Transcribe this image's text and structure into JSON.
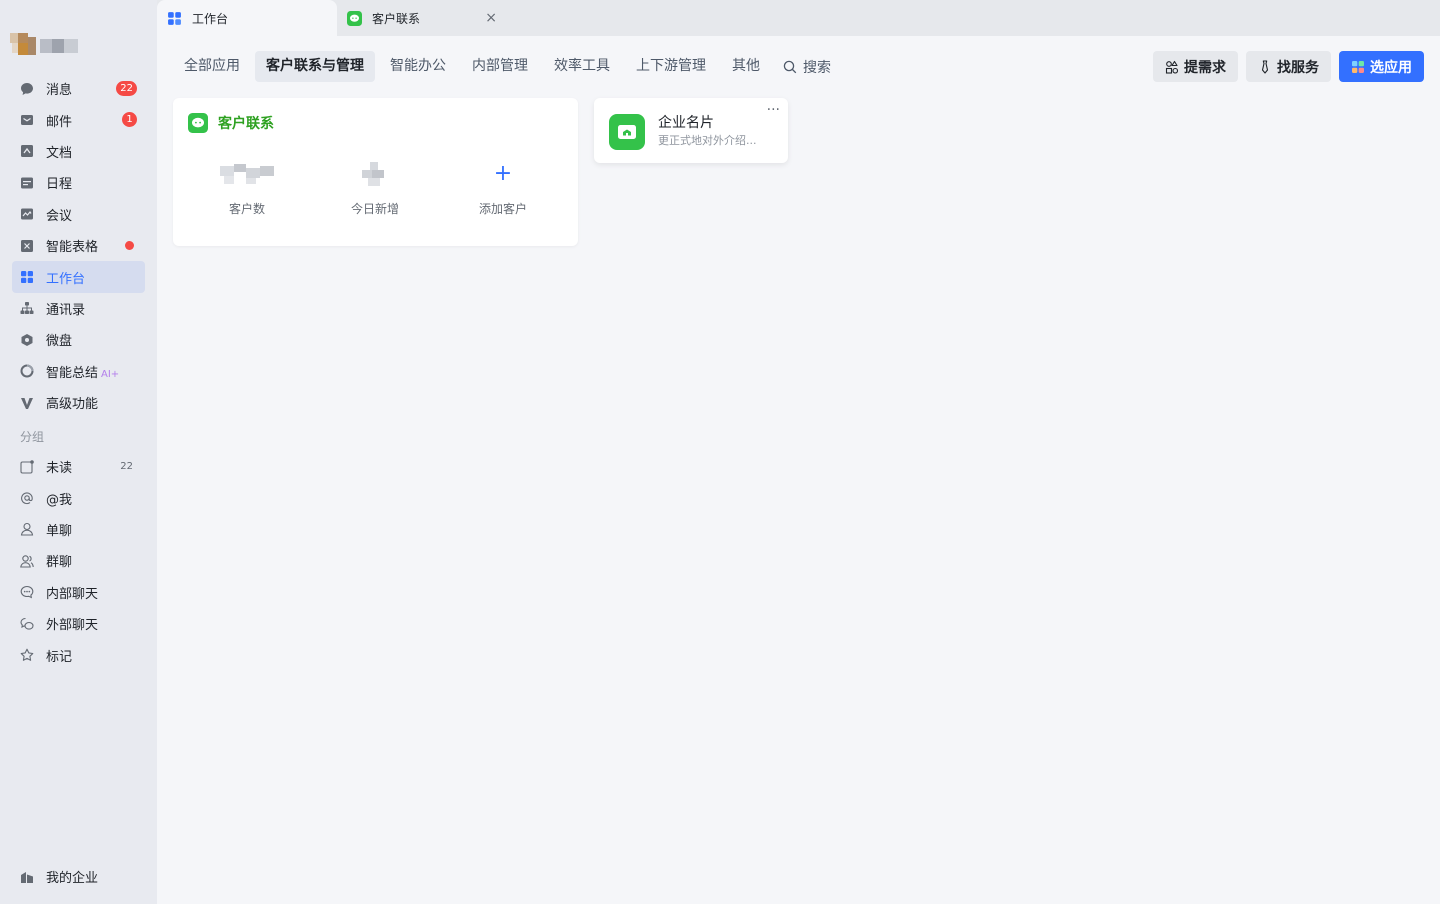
{
  "sidebar": {
    "nav": [
      {
        "label": "消息",
        "icon": "chat-bubble-icon",
        "badge": "22"
      },
      {
        "label": "邮件",
        "icon": "mail-icon",
        "badge": "1"
      },
      {
        "label": "文档",
        "icon": "doc-icon"
      },
      {
        "label": "日程",
        "icon": "calendar-icon"
      },
      {
        "label": "会议",
        "icon": "meeting-icon"
      },
      {
        "label": "智能表格",
        "icon": "sheet-icon",
        "dot": true
      },
      {
        "label": "工作台",
        "icon": "workbench-icon",
        "active": true
      },
      {
        "label": "通讯录",
        "icon": "contacts-icon"
      },
      {
        "label": "微盘",
        "icon": "drive-icon"
      },
      {
        "label": "智能总结",
        "icon": "summary-icon",
        "tag": "AI+"
      },
      {
        "label": "高级功能",
        "icon": "advanced-icon"
      }
    ],
    "group_title": "分组",
    "groups": [
      {
        "label": "未读",
        "icon": "unread-icon",
        "count": "22"
      },
      {
        "label": "@我",
        "icon": "at-icon"
      },
      {
        "label": "单聊",
        "icon": "person-icon"
      },
      {
        "label": "群聊",
        "icon": "group-icon"
      },
      {
        "label": "内部聊天",
        "icon": "internal-chat-icon"
      },
      {
        "label": "外部聊天",
        "icon": "external-chat-icon"
      },
      {
        "label": "标记",
        "icon": "star-icon"
      }
    ],
    "bottom": {
      "label": "我的企业",
      "icon": "enterprise-icon"
    }
  },
  "tabs": [
    {
      "label": "工作台",
      "icon": "workbench-icon"
    },
    {
      "label": "客户联系",
      "icon": "customer-contact-icon",
      "close": "×"
    }
  ],
  "categories": [
    {
      "label": "全部应用"
    },
    {
      "label": "客户联系与管理",
      "active": true
    },
    {
      "label": "智能办公"
    },
    {
      "label": "内部管理"
    },
    {
      "label": "效率工具"
    },
    {
      "label": "上下游管理"
    },
    {
      "label": "其他"
    }
  ],
  "search_label": "搜索",
  "actions": {
    "request": "提需求",
    "service": "找服务",
    "select": "选应用"
  },
  "crm_card": {
    "title": "客户联系",
    "stats": [
      {
        "label": "客户数"
      },
      {
        "label": "今日新增"
      },
      {
        "label": "添加客户",
        "symbol": "+"
      }
    ]
  },
  "app_card": {
    "name": "企业名片",
    "desc": "更正式地对外介绍...",
    "more": "···"
  },
  "colors": {
    "accent": "#3370ff",
    "green": "#2ea121",
    "badge": "#f54a45"
  }
}
